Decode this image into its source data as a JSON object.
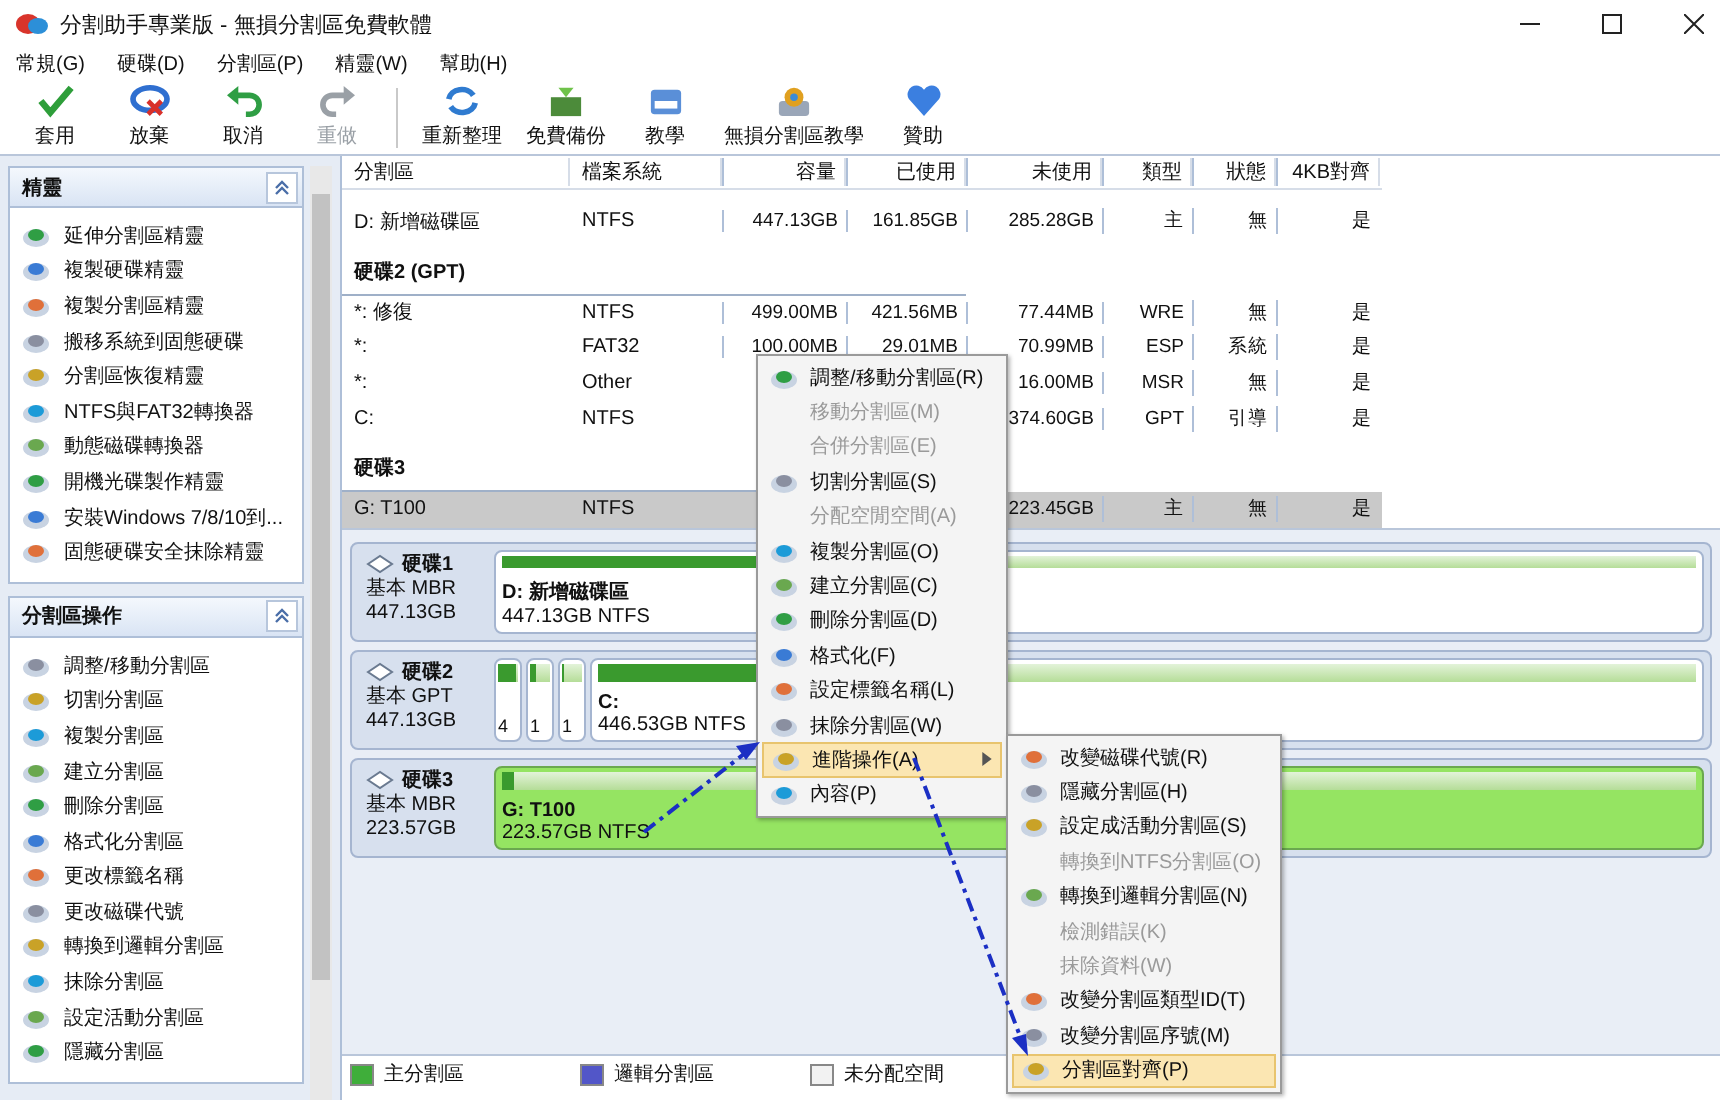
{
  "window": {
    "title": "分割助手專業版 - 無損分割區免費軟體"
  },
  "menu_bar": [
    "常規(G)",
    "硬碟(D)",
    "分割區(P)",
    "精靈(W)",
    "幫助(H)"
  ],
  "toolbar": {
    "groups": [
      [
        {
          "label": "套用",
          "disabled": false
        },
        {
          "label": "放棄",
          "disabled": false
        },
        {
          "label": "取消",
          "disabled": false
        },
        {
          "label": "重做",
          "disabled": true
        }
      ],
      [
        {
          "label": "重新整理",
          "disabled": false
        },
        {
          "label": "免費備份",
          "disabled": false
        },
        {
          "label": "教學",
          "disabled": false
        },
        {
          "label": "無損分割區教學",
          "disabled": false
        },
        {
          "label": "贊助",
          "disabled": false
        }
      ]
    ]
  },
  "sidebar": {
    "panels": [
      {
        "title": "精靈",
        "expanded": true,
        "items": [
          "延伸分割區精靈",
          "複製硬碟精靈",
          "複製分割區精靈",
          "搬移系統到固態硬碟",
          "分割區恢復精靈",
          "NTFS與FAT32轉換器",
          "動態磁碟轉換器",
          "開機光碟製作精靈",
          "安裝Windows 7/8/10到...",
          "固態硬碟安全抹除精靈"
        ]
      },
      {
        "title": "分割區操作",
        "expanded": true,
        "items": [
          "調整/移動分割區",
          "切割分割區",
          "複製分割區",
          "建立分割區",
          "刪除分割區",
          "格式化分割區",
          "更改標籤名稱",
          "更改磁碟代號",
          "轉換到邏輯分割區",
          "抹除分割區",
          "設定活動分割區",
          "隱藏分割區"
        ]
      }
    ]
  },
  "partition_table": {
    "columns": [
      "分割區",
      "檔案系統",
      "容量",
      "已使用",
      "未使用",
      "類型",
      "狀態",
      "4KB對齊"
    ],
    "rows": [
      {
        "kind": "partition",
        "selected": false,
        "cells": [
          "D: 新增磁碟區",
          "NTFS",
          "447.13GB",
          "161.85GB",
          "285.28GB",
          "主",
          "無",
          "是"
        ]
      },
      {
        "kind": "disk_header",
        "label": "硬碟2 (GPT)"
      },
      {
        "kind": "partition",
        "selected": false,
        "cells": [
          "*: 修復",
          "NTFS",
          "499.00MB",
          "421.56MB",
          "77.44MB",
          "WRE",
          "無",
          "是"
        ]
      },
      {
        "kind": "partition",
        "selected": false,
        "cells": [
          "*:",
          "FAT32",
          "100.00MB",
          "29.01MB",
          "70.99MB",
          "ESP",
          "系統",
          "是"
        ]
      },
      {
        "kind": "partition",
        "selected": false,
        "cells": [
          "*:",
          "Other",
          "",
          "",
          "16.00MB",
          "MSR",
          "無",
          "是"
        ]
      },
      {
        "kind": "partition",
        "selected": false,
        "cells": [
          "C:",
          "NTFS",
          "",
          "",
          "374.60GB",
          "GPT",
          "引導",
          "是"
        ]
      },
      {
        "kind": "disk_header",
        "label": "硬碟3"
      },
      {
        "kind": "partition",
        "selected": true,
        "cells": [
          "G: T100",
          "NTFS",
          "",
          "",
          "223.45GB",
          "主",
          "無",
          "是"
        ]
      }
    ]
  },
  "disk_map": {
    "disks": [
      {
        "name": "硬碟1",
        "scheme": "基本 MBR",
        "size": "447.13GB",
        "partitions": [
          {
            "kind": "large",
            "name": "D: 新增磁碟區",
            "detail": "447.13GB NTFS",
            "level": 0.36,
            "selected": false
          }
        ]
      },
      {
        "name": "硬碟2",
        "scheme": "基本 GPT",
        "size": "447.13GB",
        "partitions": [
          {
            "kind": "small",
            "detail": "4",
            "level": 0.85,
            "selected": false
          },
          {
            "kind": "small",
            "detail": "1",
            "level": 0.3,
            "selected": false
          },
          {
            "kind": "small",
            "detail": "1",
            "level": 0.1,
            "selected": false
          },
          {
            "kind": "large",
            "name": "C:",
            "detail": "446.53GB NTFS",
            "level": 0.16,
            "selected": false
          }
        ]
      },
      {
        "name": "硬碟3",
        "scheme": "基本 MBR",
        "size": "223.57GB",
        "partitions": [
          {
            "kind": "large",
            "name": "G: T100",
            "detail": "223.57GB NTFS",
            "level": 0.01,
            "selected": true
          }
        ]
      }
    ]
  },
  "legend": [
    {
      "label": "主分割區",
      "color": "#3fae3a"
    },
    {
      "label": "邏輯分割區",
      "color": "#5256c8"
    },
    {
      "label": "未分配空間",
      "color": "#f2f2f2"
    }
  ],
  "context_menu": {
    "items": [
      {
        "label": "調整/移動分割區(R)",
        "disabled": false,
        "selected": false,
        "submenu": false
      },
      {
        "label": "移動分割區(M)",
        "disabled": true,
        "selected": false,
        "submenu": false
      },
      {
        "label": "合併分割區(E)",
        "disabled": true,
        "selected": false,
        "submenu": false
      },
      {
        "label": "切割分割區(S)",
        "disabled": false,
        "selected": false,
        "submenu": false
      },
      {
        "label": "分配空閒空間(A)",
        "disabled": true,
        "selected": false,
        "submenu": false
      },
      {
        "label": "複製分割區(O)",
        "disabled": false,
        "selected": false,
        "submenu": false
      },
      {
        "label": "建立分割區(C)",
        "disabled": false,
        "selected": false,
        "submenu": false
      },
      {
        "label": "刪除分割區(D)",
        "disabled": false,
        "selected": false,
        "submenu": false
      },
      {
        "label": "格式化(F)",
        "disabled": false,
        "selected": false,
        "submenu": false
      },
      {
        "label": "設定標籤名稱(L)",
        "disabled": false,
        "selected": false,
        "submenu": false
      },
      {
        "label": "抹除分割區(W)",
        "disabled": false,
        "selected": false,
        "submenu": false
      },
      {
        "label": "進階操作(A)",
        "disabled": false,
        "selected": true,
        "submenu": true
      },
      {
        "label": "內容(P)",
        "disabled": false,
        "selected": false,
        "submenu": false
      }
    ]
  },
  "submenu": {
    "items": [
      {
        "label": "改變磁碟代號(R)",
        "disabled": false,
        "selected": false
      },
      {
        "label": "隱藏分割區(H)",
        "disabled": false,
        "selected": false
      },
      {
        "label": "設定成活動分割區(S)",
        "disabled": false,
        "selected": false
      },
      {
        "label": "轉換到NTFS分割區(O)",
        "disabled": true,
        "selected": false
      },
      {
        "label": "轉換到邏輯分割區(N)",
        "disabled": false,
        "selected": false
      },
      {
        "label": "檢測錯誤(K)",
        "disabled": true,
        "selected": false
      },
      {
        "label": "抹除資料(W)",
        "disabled": true,
        "selected": false
      },
      {
        "label": "改變分割區類型ID(T)",
        "disabled": false,
        "selected": false
      },
      {
        "label": "改變分割區序號(M)",
        "disabled": false,
        "selected": false
      },
      {
        "label": "分割區對齊(P)",
        "disabled": false,
        "selected": true
      }
    ]
  }
}
